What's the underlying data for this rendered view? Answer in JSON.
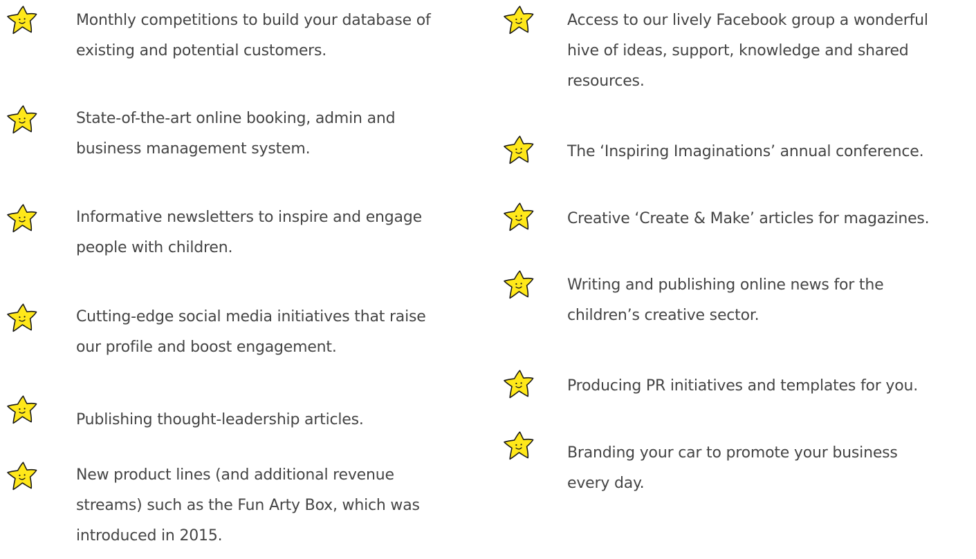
{
  "colors": {
    "text": "#444444",
    "star_fill": "#FFE81A",
    "star_stroke": "#1a1a1a"
  },
  "icon": "smiling-star-icon",
  "left_items": [
    {
      "lines": [
        "Monthly competitions to build your database of",
        "existing and potential customers."
      ]
    },
    {
      "lines": [
        "State-of-the-art online booking, admin and",
        "business management system."
      ]
    },
    {
      "lines": [
        "Informative newsletters to inspire and engage",
        "people with children."
      ]
    },
    {
      "lines": [
        "Cutting-edge social media initiatives that raise",
        "our profile and boost engagement."
      ]
    },
    {
      "lines": [
        "Publishing thought-leadership articles."
      ]
    },
    {
      "lines": [
        "New product lines (and additional revenue",
        "streams) such as the Fun Arty Box, which was",
        "introduced in 2015."
      ]
    }
  ],
  "right_items": [
    {
      "lines": [
        "Access to our lively Facebook group a wonderful",
        "hive of ideas, support, knowledge and shared",
        "resources."
      ]
    },
    {
      "lines": [
        "The ‘Inspiring Imaginations’ annual conference."
      ]
    },
    {
      "lines": [
        "Creative ‘Create & Make’ articles for magazines."
      ]
    },
    {
      "lines": [
        "Writing and publishing online news for the",
        "children’s creative sector."
      ]
    },
    {
      "lines": [
        "Producing PR initiatives and templates for you."
      ]
    },
    {
      "lines": [
        "Branding your car to promote your business",
        "every day."
      ]
    }
  ]
}
